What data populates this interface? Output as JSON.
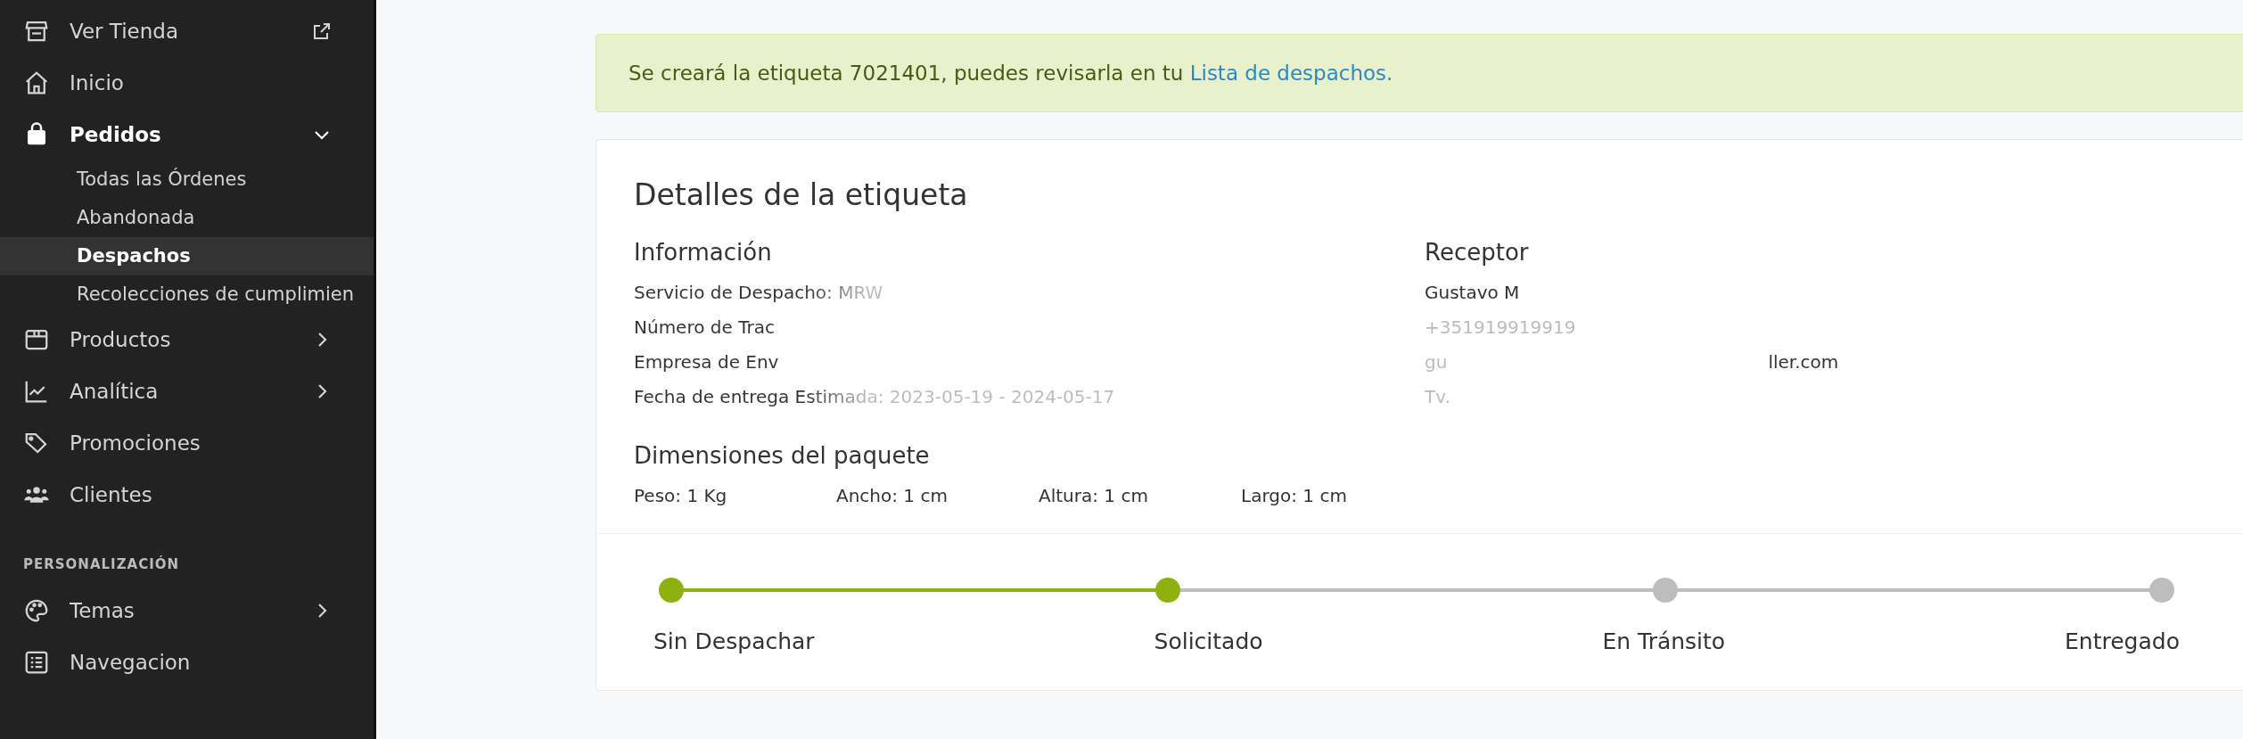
{
  "sidebar": {
    "items": [
      {
        "label": "Ver Tienda",
        "kind": "external"
      },
      {
        "label": "Inicio",
        "kind": "item"
      },
      {
        "label": "Pedidos",
        "kind": "group",
        "expanded": true,
        "children": [
          {
            "label": "Todas las Órdenes",
            "selected": false
          },
          {
            "label": "Abandonada",
            "selected": false
          },
          {
            "label": "Despachos",
            "selected": true
          },
          {
            "label": "Recolecciones de cumplimien",
            "selected": false
          }
        ]
      },
      {
        "label": "Productos",
        "kind": "group",
        "expanded": false
      },
      {
        "label": "Analítica",
        "kind": "group",
        "expanded": false
      },
      {
        "label": "Promociones",
        "kind": "item"
      },
      {
        "label": "Clientes",
        "kind": "item"
      }
    ],
    "section_title": "PERSONALIZACIÓN",
    "section_items": [
      {
        "label": "Temas",
        "kind": "group",
        "expanded": false
      },
      {
        "label": "Navegacion",
        "kind": "item"
      }
    ]
  },
  "alert": {
    "text": "Se creará la etiqueta 7021401, puedes revisarla en tu",
    "link": "Lista de despachos."
  },
  "card": {
    "title": "Detalles de la etiqueta",
    "info": {
      "heading": "Información",
      "lines": [
        "Servicio de Despacho: MRW",
        "Número de Trac",
        "Empresa de Env",
        "Fecha de entrega Estimada: 2023-05-19 - 2024-05-17"
      ]
    },
    "receiver": {
      "heading": "Receptor",
      "name": "Gustavo M",
      "lines": [
        [
          "+351919919919"
        ],
        [
          "gu",
          "ller.com"
        ],
        [
          "Tv."
        ]
      ]
    },
    "dimensions": {
      "heading": "Dimensiones del paquete",
      "values": [
        "Peso: 1 Kg",
        "Ancho: 1 cm",
        "Altura: 1 cm",
        "Largo: 1 cm"
      ]
    },
    "steps": [
      {
        "label": "Sin Despachar",
        "completed": true
      },
      {
        "label": "Solicitado",
        "completed": true
      },
      {
        "label": "En Tránsito",
        "completed": false
      },
      {
        "label": "Entregado",
        "completed": false
      }
    ]
  }
}
